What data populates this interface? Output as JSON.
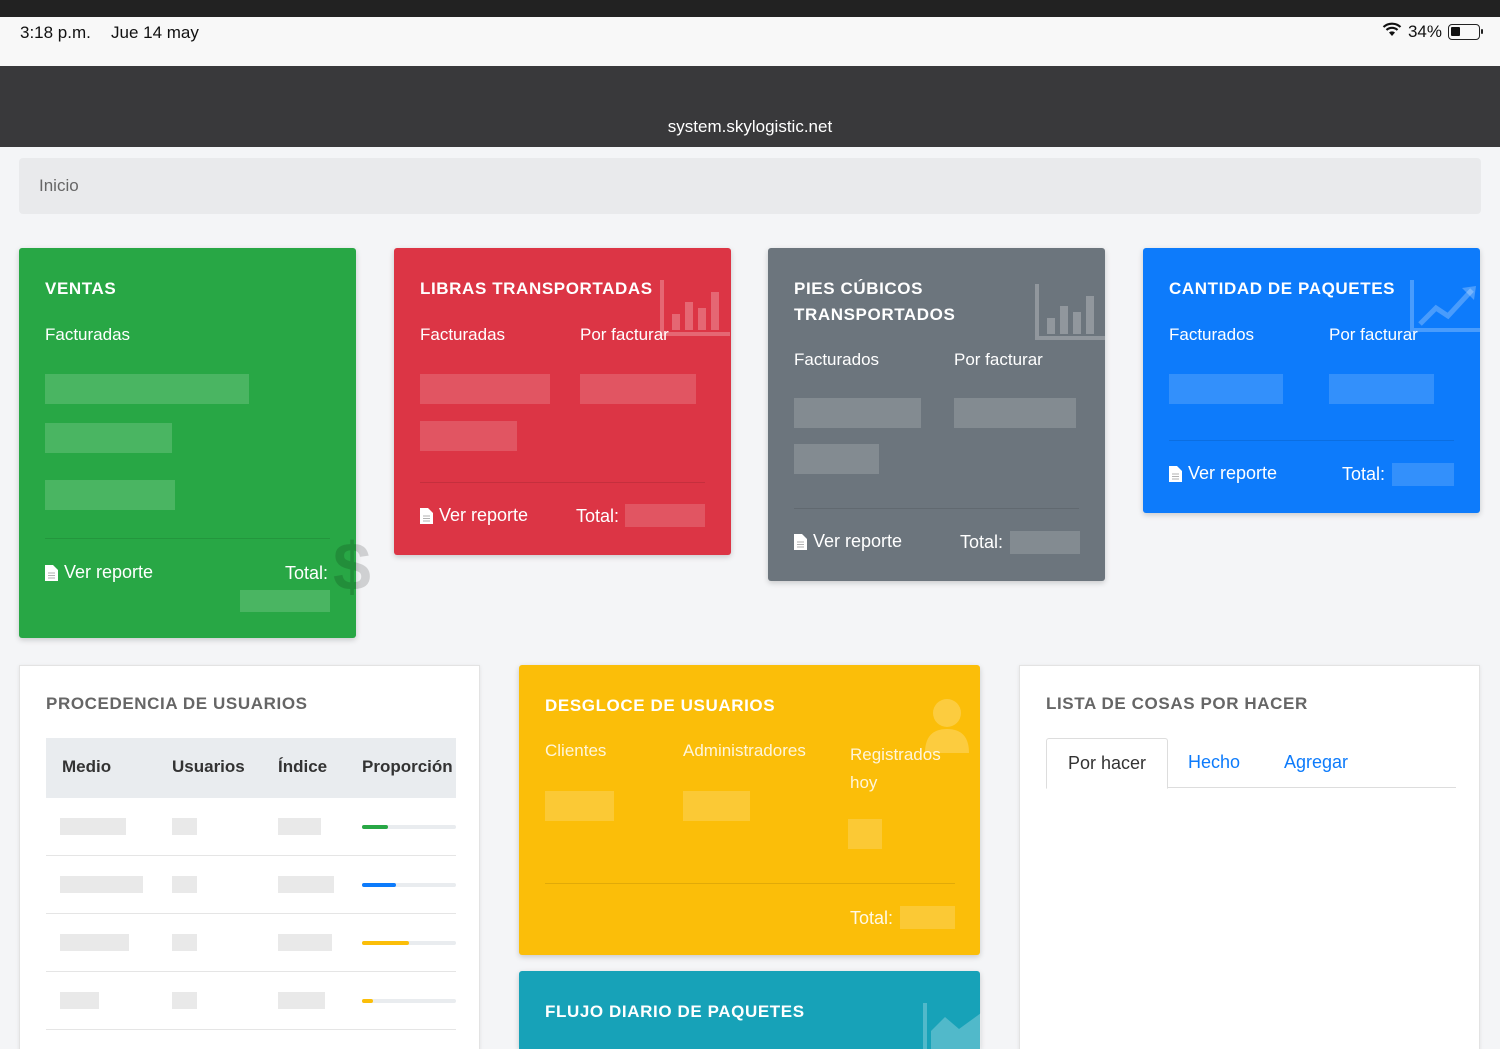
{
  "statusbar": {
    "time": "3:18 p.m.",
    "date": "Jue 14 may",
    "battery": "34%"
  },
  "browser": {
    "url": "system.skylogistic.net"
  },
  "breadcrumb": {
    "label": "Inicio"
  },
  "ventas": {
    "title": "VENTAS",
    "col1": "Facturadas",
    "report": "Ver reporte",
    "total": "Total:",
    "color": "#28a745",
    "icon": "dollar-icon"
  },
  "libras": {
    "title": "LIBRAS TRANSPORTADAS",
    "col1": "Facturadas",
    "col2": "Por facturar",
    "report": "Ver reporte",
    "total": "Total:",
    "color": "#dc3545",
    "icon": "bar-chart-icon"
  },
  "pies": {
    "title_line1": "PIES CÚBICOS",
    "title_line2": "TRANSPORTADOS",
    "col1": "Facturados",
    "col2": "Por facturar",
    "report": "Ver reporte",
    "total": "Total:",
    "color": "#6c757d",
    "icon": "bar-chart-icon"
  },
  "paquetes": {
    "title": "CANTIDAD DE PAQUETES",
    "col1": "Facturados",
    "col2": "Por facturar",
    "report": "Ver reporte",
    "total": "Total:",
    "color": "#0d7bfb",
    "icon": "line-chart-icon"
  },
  "procedencia": {
    "title": "PROCEDENCIA DE USUARIOS",
    "headers": [
      "Medio",
      "Usuarios",
      "Índice",
      "Proporción"
    ],
    "rows": [
      {
        "proportion": 0.28,
        "color": "#28a745"
      },
      {
        "proportion": 0.36,
        "color": "#0d7bfb"
      },
      {
        "proportion": 0.5,
        "color": "#fbbe09"
      },
      {
        "proportion": 0.12,
        "color": "#fbbe09"
      }
    ]
  },
  "desgloce": {
    "title": "DESGLOCE DE USUARIOS",
    "col1": "Clientes",
    "col2": "Administradores",
    "col3_line1": "Registrados",
    "col3_line2": "hoy",
    "total": "Total:",
    "color": "#fbbe09",
    "icon": "user-icon"
  },
  "flujo": {
    "title": "FLUJO DIARIO DE PAQUETES",
    "color": "#17a2b8",
    "icon": "area-chart-icon"
  },
  "lista": {
    "title": "LISTA DE COSAS POR HACER",
    "tabs": [
      "Por hacer",
      "Hecho",
      "Agregar"
    ],
    "active_tab": "Por hacer"
  }
}
